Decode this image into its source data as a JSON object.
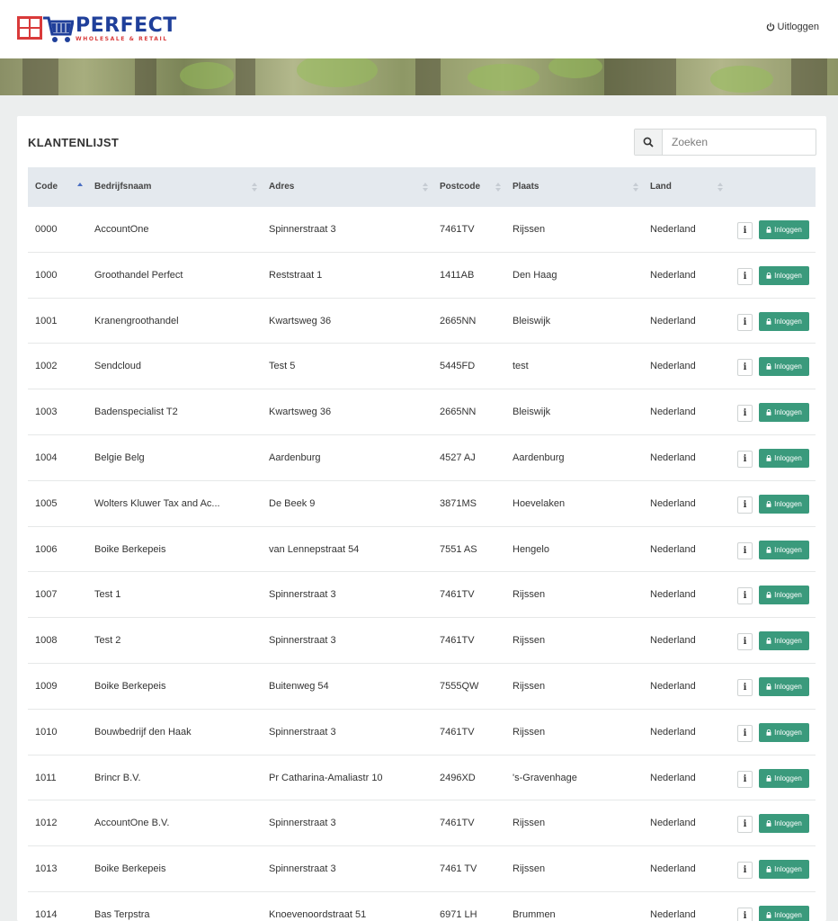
{
  "brand": {
    "name": "PERFECT",
    "tagline": "WHOLESALE & RETAIL",
    "logo_icon": "cart-logo-icon",
    "primary_color": "#1f3f9a",
    "accent_color": "#d93a3a"
  },
  "header": {
    "logout_label": "Uitloggen",
    "logout_icon": "power-icon"
  },
  "page": {
    "title": "KLANTENLIJST"
  },
  "search": {
    "placeholder": "Zoeken",
    "icon": "search-icon"
  },
  "table": {
    "columns": [
      "Code",
      "Bedrijfsnaam",
      "Adres",
      "Postcode",
      "Plaats",
      "Land"
    ],
    "sorted_by": "Code",
    "sort_direction": "asc",
    "info_label": "i",
    "login_label": "Inloggen",
    "login_color": "#3a9a7c",
    "rows": [
      [
        "0000",
        "AccountOne",
        "Spinnerstraat 3",
        "7461TV",
        "Rijssen",
        "Nederland"
      ],
      [
        "1000",
        "Groothandel Perfect",
        "Reststraat 1",
        "1411AB",
        "Den Haag",
        "Nederland"
      ],
      [
        "1001",
        "Kranengroothandel",
        "Kwartsweg 36",
        "2665NN",
        "Bleiswijk",
        "Nederland"
      ],
      [
        "1002",
        "Sendcloud",
        "Test 5",
        "5445FD",
        "test",
        "Nederland"
      ],
      [
        "1003",
        "Badenspecialist T2",
        "Kwartsweg 36",
        "2665NN",
        "Bleiswijk",
        "Nederland"
      ],
      [
        "1004",
        "Belgie Belg",
        "Aardenburg",
        "4527 AJ",
        "Aardenburg",
        "Nederland"
      ],
      [
        "1005",
        "Wolters Kluwer Tax and Ac...",
        "De Beek 9",
        "3871MS",
        "Hoevelaken",
        "Nederland"
      ],
      [
        "1006",
        "Boike Berkepeis",
        "van Lennepstraat 54",
        "7551 AS",
        "Hengelo",
        "Nederland"
      ],
      [
        "1007",
        "Test 1",
        "Spinnerstraat 3",
        "7461TV",
        "Rijssen",
        "Nederland"
      ],
      [
        "1008",
        "Test 2",
        "Spinnerstraat 3",
        "7461TV",
        "Rijssen",
        "Nederland"
      ],
      [
        "1009",
        "Boike Berkepeis",
        "Buitenweg 54",
        "7555QW",
        "Rijssen",
        "Nederland"
      ],
      [
        "1010",
        "Bouwbedrijf den Haak",
        "Spinnerstraat 3",
        "7461TV",
        "Rijssen",
        "Nederland"
      ],
      [
        "1011",
        "Brincr B.V.",
        "Pr Catharina-Amaliastr 10",
        "2496XD",
        "'s-Gravenhage",
        "Nederland"
      ],
      [
        "1012",
        "AccountOne B.V.",
        "Spinnerstraat 3",
        "7461TV",
        "Rijssen",
        "Nederland"
      ],
      [
        "1013",
        "Boike Berkepeis",
        "Spinnerstraat 3",
        "7461 TV",
        "Rijssen",
        "Nederland"
      ],
      [
        "1014",
        "Bas Terpstra",
        "Knoevenoordstraat 51",
        "6971 LH",
        "Brummen",
        "Nederland"
      ]
    ]
  }
}
